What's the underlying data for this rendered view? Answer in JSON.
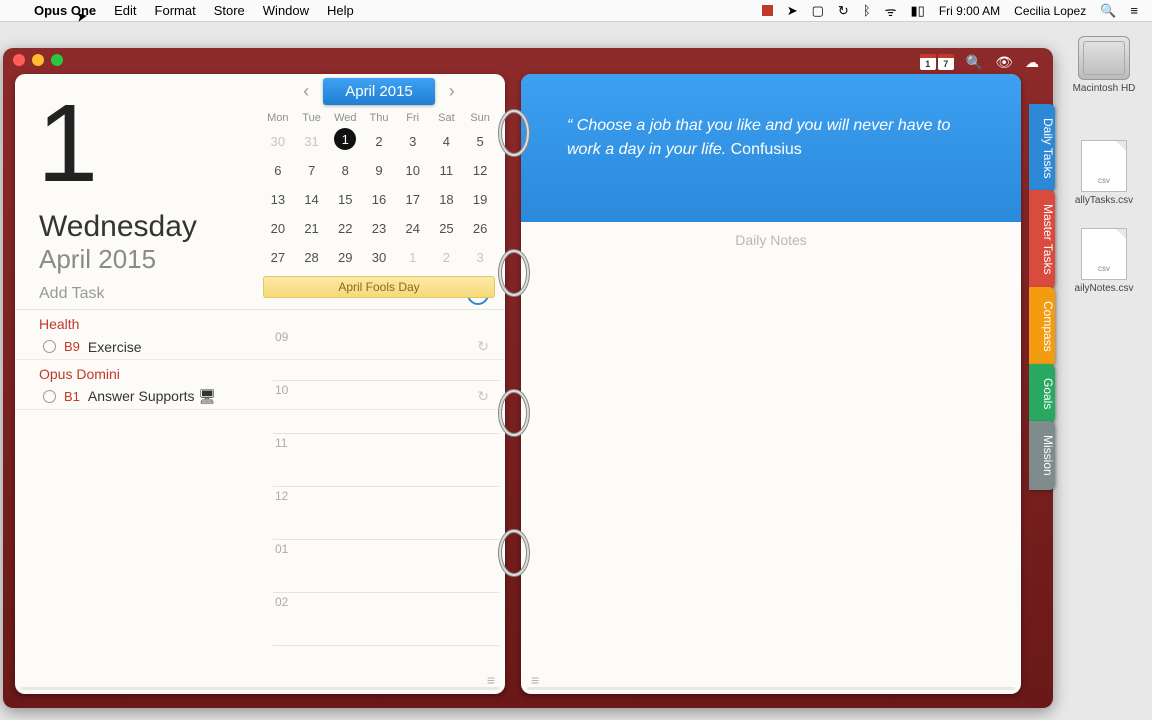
{
  "menubar": {
    "app": "Opus One",
    "items": [
      "Edit",
      "Format",
      "Store",
      "Window",
      "Help"
    ],
    "clock": "Fri 9:00 AM",
    "user": "Cecilia Lopez"
  },
  "desktop": {
    "hd_label": "Macintosh HD",
    "file1_label": "allyTasks.csv",
    "file2_label": "ailyNotes.csv"
  },
  "toolbar": {
    "day1": "1",
    "day7": "7"
  },
  "left_page": {
    "big_date": "1",
    "weekday": "Wednesday",
    "month": "April 2015",
    "add_task": "Add Task",
    "cat1": "Health",
    "task1_pri": "B9",
    "task1": "Exercise",
    "cat2": "Opus Domini",
    "task2_pri": "B1",
    "task2": "Answer Supports 🖥"
  },
  "mini_month": {
    "title": "April 2015",
    "weekdays": [
      "Mon",
      "Tue",
      "Wed",
      "Thu",
      "Fri",
      "Sat",
      "Sun"
    ],
    "banner": "April Fools Day"
  },
  "hours": {
    "h09": "09",
    "h10": "10",
    "h11": "11",
    "h12": "12",
    "h01": "01",
    "h02": "02"
  },
  "right_page": {
    "quote": "Choose a job that you like and you will never have to work a day in your life. ",
    "quote_author": "Confusius",
    "daily_notes": "Daily Notes"
  },
  "tabs": {
    "t1": "Daily Tasks",
    "t2": "Master Tasks",
    "t3": "Compass",
    "t4": "Goals",
    "t5": "Mission"
  }
}
